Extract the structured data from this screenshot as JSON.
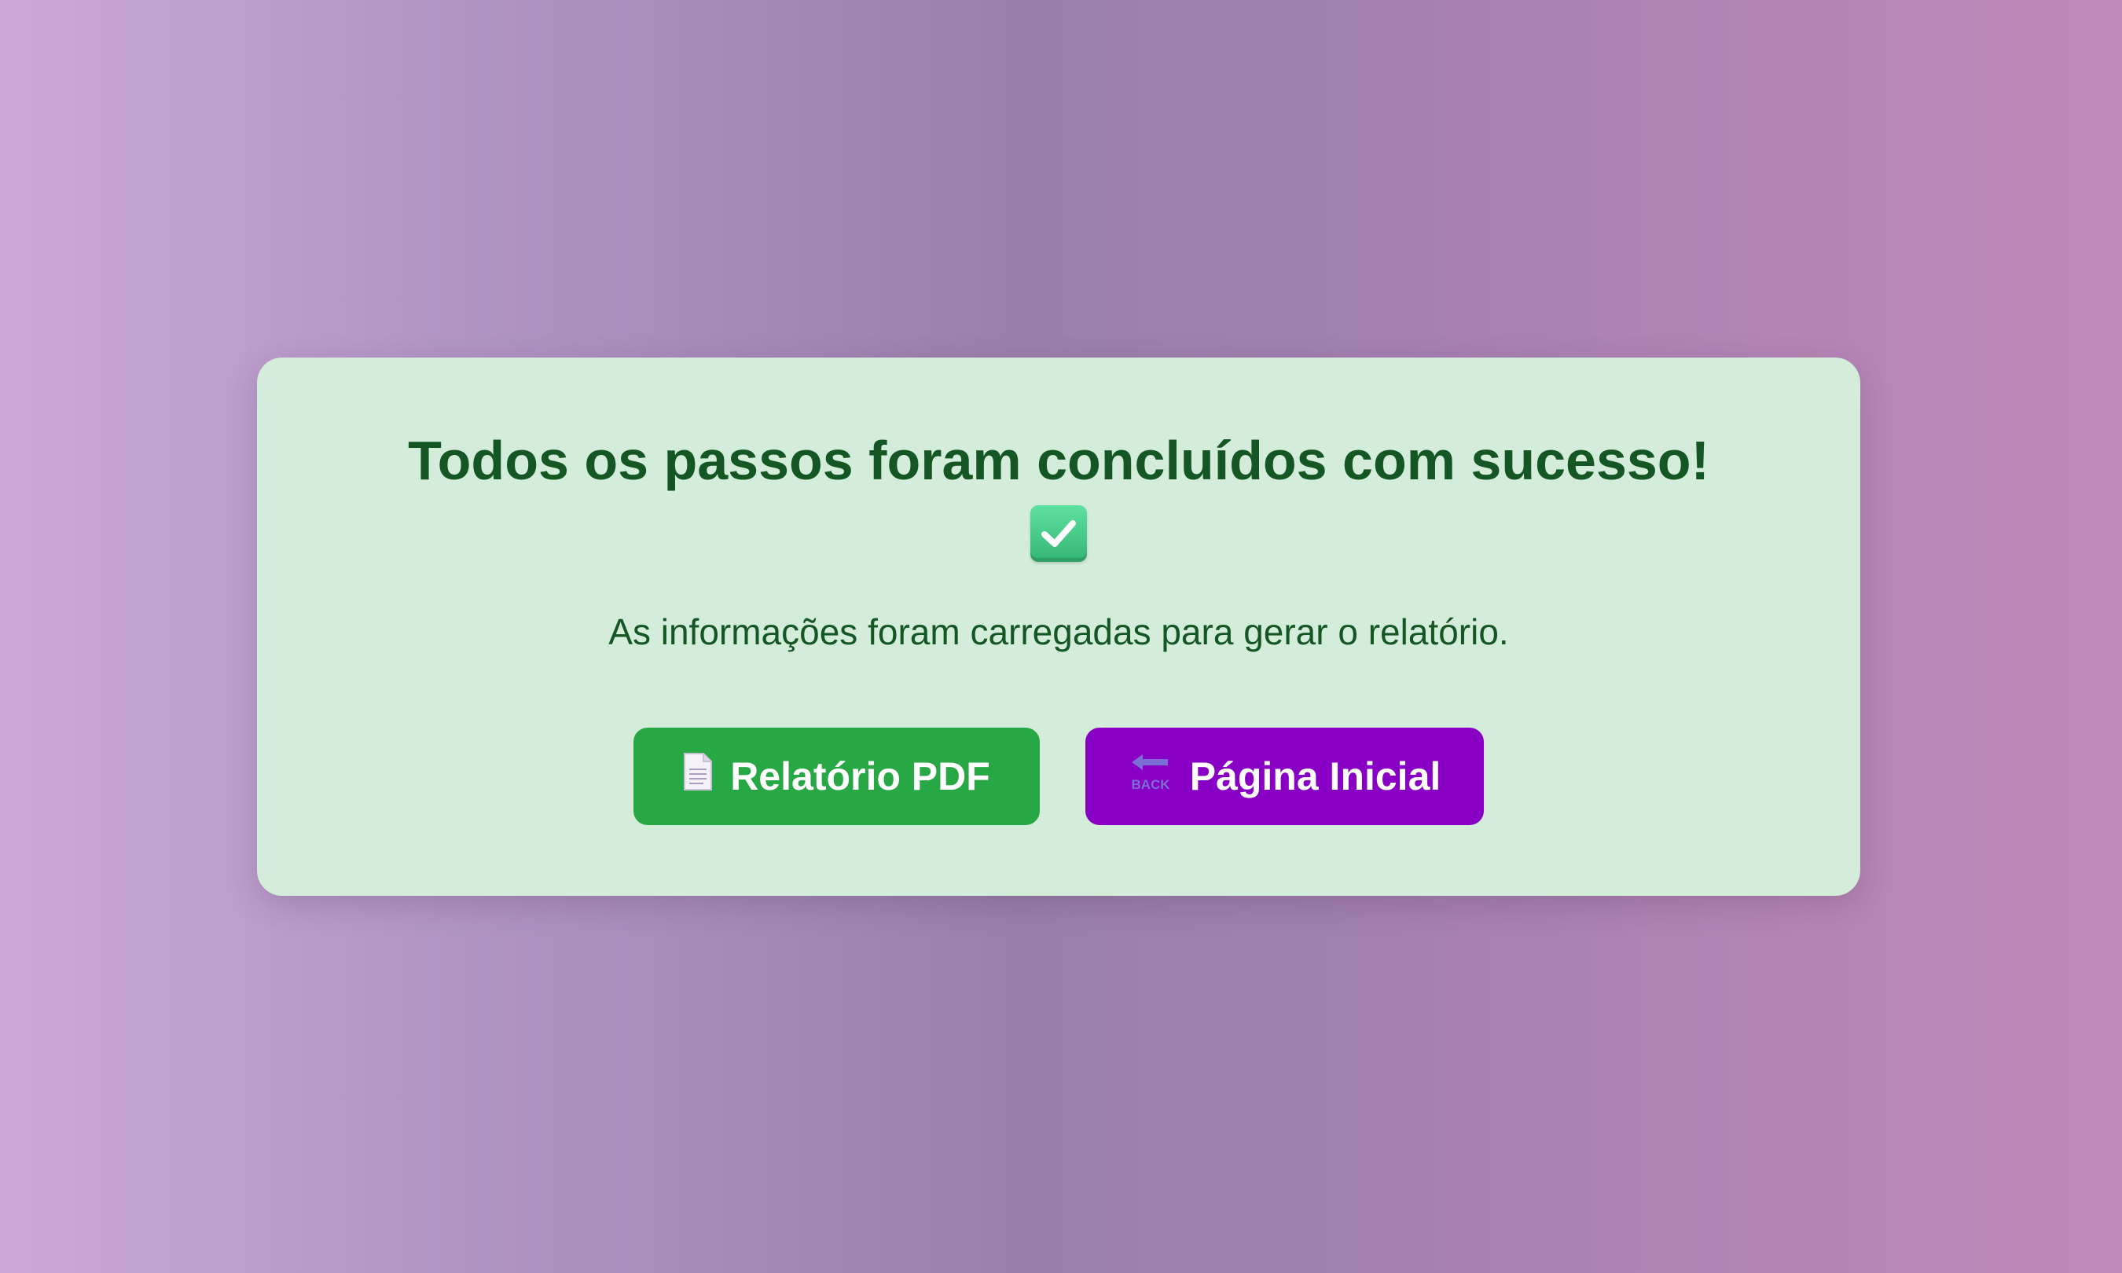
{
  "card": {
    "title": "Todos os passos foram concluídos com sucesso!",
    "message": "As informações foram carregadas para gerar o relatório."
  },
  "buttons": {
    "pdf_label": "Relatório PDF",
    "home_label": "Página Inicial",
    "back_icon_text": "BACK"
  },
  "icons": {
    "status": "check-mark-button-icon",
    "pdf": "page-facing-up-icon",
    "home": "back-arrow-icon"
  },
  "colors": {
    "card_background": "#d4ecda",
    "text_green": "#155724",
    "pdf_button": "#28a745",
    "home_button": "#8700c4"
  }
}
